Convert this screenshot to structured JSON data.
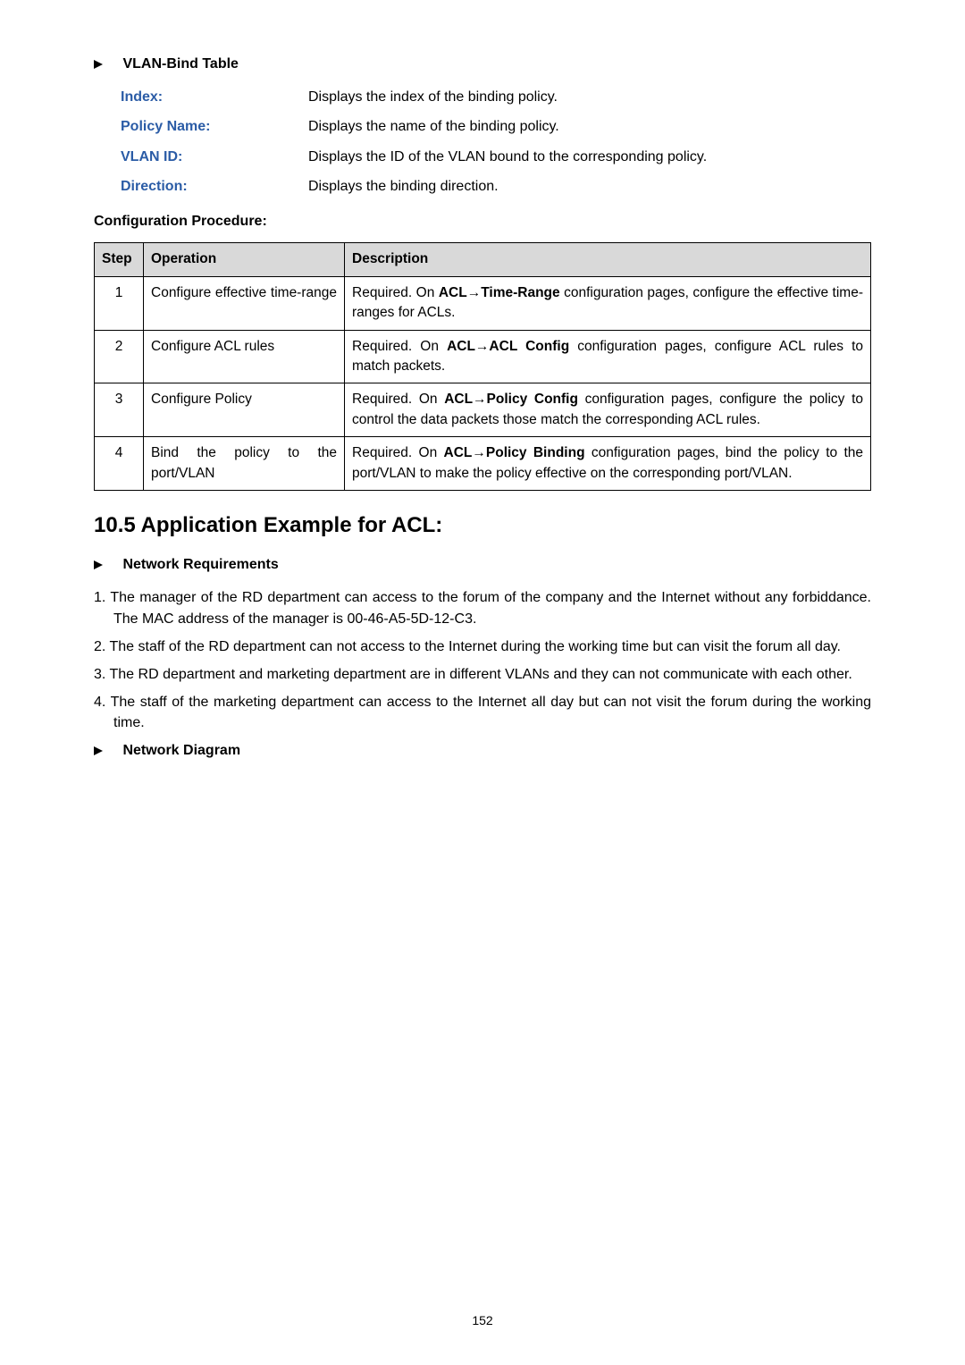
{
  "vlanBind": {
    "heading": "VLAN-Bind Table",
    "rows": [
      {
        "term": "Index:",
        "def": "Displays the index of the binding policy."
      },
      {
        "term": "Policy Name:",
        "def": "Displays the name of the binding policy."
      },
      {
        "term": "VLAN ID:",
        "def": "Displays the ID of the VLAN bound to the corresponding policy."
      },
      {
        "term": "Direction:",
        "def": "Displays the binding direction."
      }
    ]
  },
  "configProc": {
    "heading": "Configuration Procedure:",
    "cols": {
      "step": "Step",
      "operation": "Operation",
      "description": "Description"
    },
    "rows": [
      {
        "step": "1",
        "op": "Configure effective time-range",
        "desc_pre": "Required. On ",
        "desc_bold": "ACL→Time-Range",
        "desc_post": " configuration pages, configure the effective time-ranges for ACLs."
      },
      {
        "step": "2",
        "op": "Configure ACL rules",
        "desc_pre": "Required. On ",
        "desc_bold": "ACL→ACL Config",
        "desc_post": " configuration pages, configure ACL rules to match packets."
      },
      {
        "step": "3",
        "op": "Configure Policy",
        "desc_pre": "Required. On ",
        "desc_bold": "ACL→Policy Config",
        "desc_post": " configuration pages, configure the policy to control the data packets those match the corresponding ACL rules."
      },
      {
        "step": "4",
        "op": "Bind the policy to the port/VLAN",
        "desc_pre": "Required. On ",
        "desc_bold": "ACL→Policy Binding",
        "desc_post": " configuration pages, bind the policy to the port/VLAN to make the policy effective on the corresponding port/VLAN."
      }
    ]
  },
  "section": {
    "title": "10.5 Application Example for ACL:"
  },
  "netReq": {
    "heading": "Network Requirements",
    "items": [
      "1. The manager of the RD department can access to the forum of the company and the Internet without any forbiddance. The MAC address of the manager is 00-46-A5-5D-12-C3.",
      "2. The staff of the RD department can not access to the Internet during the working time but can visit the forum all day.",
      "3. The RD department and marketing department are in different VLANs and they can not communicate with each other.",
      "4. The staff of the marketing department can access to the Internet all day but can not visit the forum during the working time."
    ]
  },
  "netDiag": {
    "heading": "Network Diagram"
  },
  "pageNumber": "152"
}
